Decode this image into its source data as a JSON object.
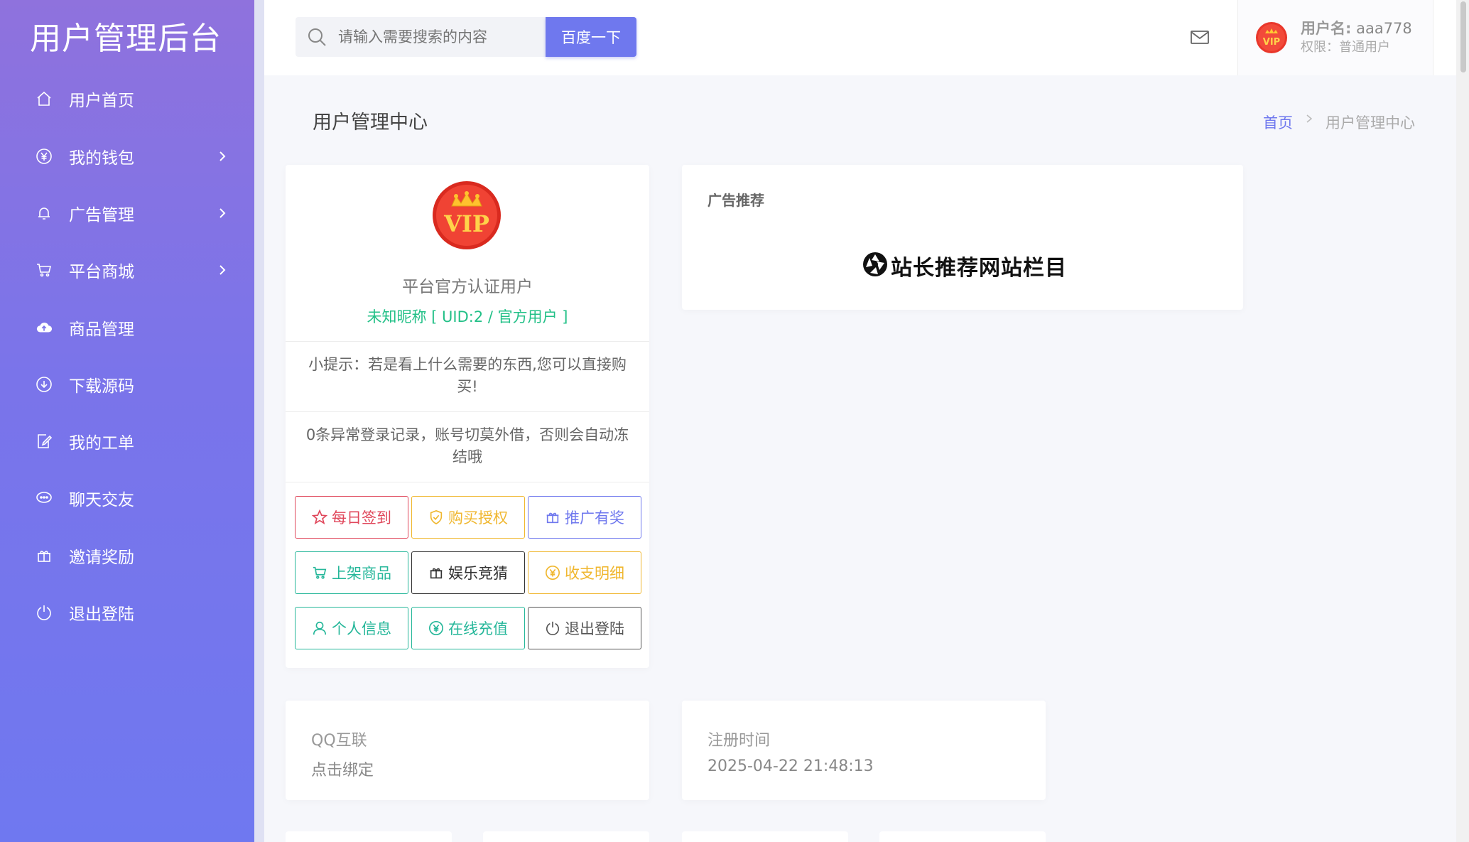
{
  "sidebar": {
    "brand": "用户管理后台",
    "items": [
      {
        "label": "用户首页",
        "icon": "home-icon",
        "arrow": false
      },
      {
        "label": "我的钱包",
        "icon": "yen-circle-icon",
        "arrow": true
      },
      {
        "label": "广告管理",
        "icon": "bell-icon",
        "arrow": true
      },
      {
        "label": "平台商城",
        "icon": "cart-icon",
        "arrow": true
      },
      {
        "label": "商品管理",
        "icon": "cloud-upload-icon",
        "arrow": false
      },
      {
        "label": "下载源码",
        "icon": "download-circle-icon",
        "arrow": false
      },
      {
        "label": "我的工单",
        "icon": "ticket-edit-icon",
        "arrow": false
      },
      {
        "label": "聊天交友",
        "icon": "chat-icon",
        "arrow": false
      },
      {
        "label": "邀请奖励",
        "icon": "gift-icon",
        "arrow": false
      },
      {
        "label": "退出登陆",
        "icon": "power-icon",
        "arrow": false
      }
    ]
  },
  "header": {
    "search_placeholder": "请输入需要搜索的内容",
    "search_button": "百度一下",
    "user": {
      "name_label": "用户名:",
      "name_value": "aaa778",
      "permission": "权限：普通用户"
    }
  },
  "page": {
    "title": "用户管理中心",
    "breadcrumb": [
      "首页",
      "用户管理中心"
    ]
  },
  "profile": {
    "title": "平台官方认证用户",
    "uid_text": "未知昵称 [ UID:2 / 官方用户 ]",
    "tip1": "小提示：若是看上什么需要的东西,您可以直接购买!",
    "tip2": "0条异常登录记录，账号切莫外借，否则会自动冻结哦",
    "buttons": [
      {
        "label": "每日签到",
        "icon": "star-icon",
        "color": "#e0475b"
      },
      {
        "label": "购买授权",
        "icon": "shield-check-icon",
        "color": "#f0b72f"
      },
      {
        "label": "推广有奖",
        "icon": "gift-icon",
        "color": "#6f78ee"
      },
      {
        "label": "上架商品",
        "icon": "cart-icon",
        "color": "#26b79a"
      },
      {
        "label": "娱乐竞猜",
        "icon": "gift-icon",
        "color": "#333333"
      },
      {
        "label": "收支明细",
        "icon": "yen-circle-icon",
        "color": "#f0b72f"
      },
      {
        "label": "个人信息",
        "icon": "user-icon",
        "color": "#26b79a"
      },
      {
        "label": "在线充值",
        "icon": "yen-circle-icon",
        "color": "#26b79a"
      },
      {
        "label": "退出登陆",
        "icon": "power-icon",
        "color": "#555555"
      }
    ]
  },
  "ad": {
    "title": "广告推荐",
    "logo_text": "站长推荐网站栏目"
  },
  "info": {
    "qq_label": "QQ互联",
    "qq_value": "点击绑定",
    "reg_label": "注册时间",
    "reg_value": "2025-04-22 21:48:13"
  },
  "colors": {
    "accent": "#6f78ee",
    "sidebar_top": "#8f72dd",
    "sidebar_bottom": "#6f78f0",
    "success": "#22c087"
  }
}
